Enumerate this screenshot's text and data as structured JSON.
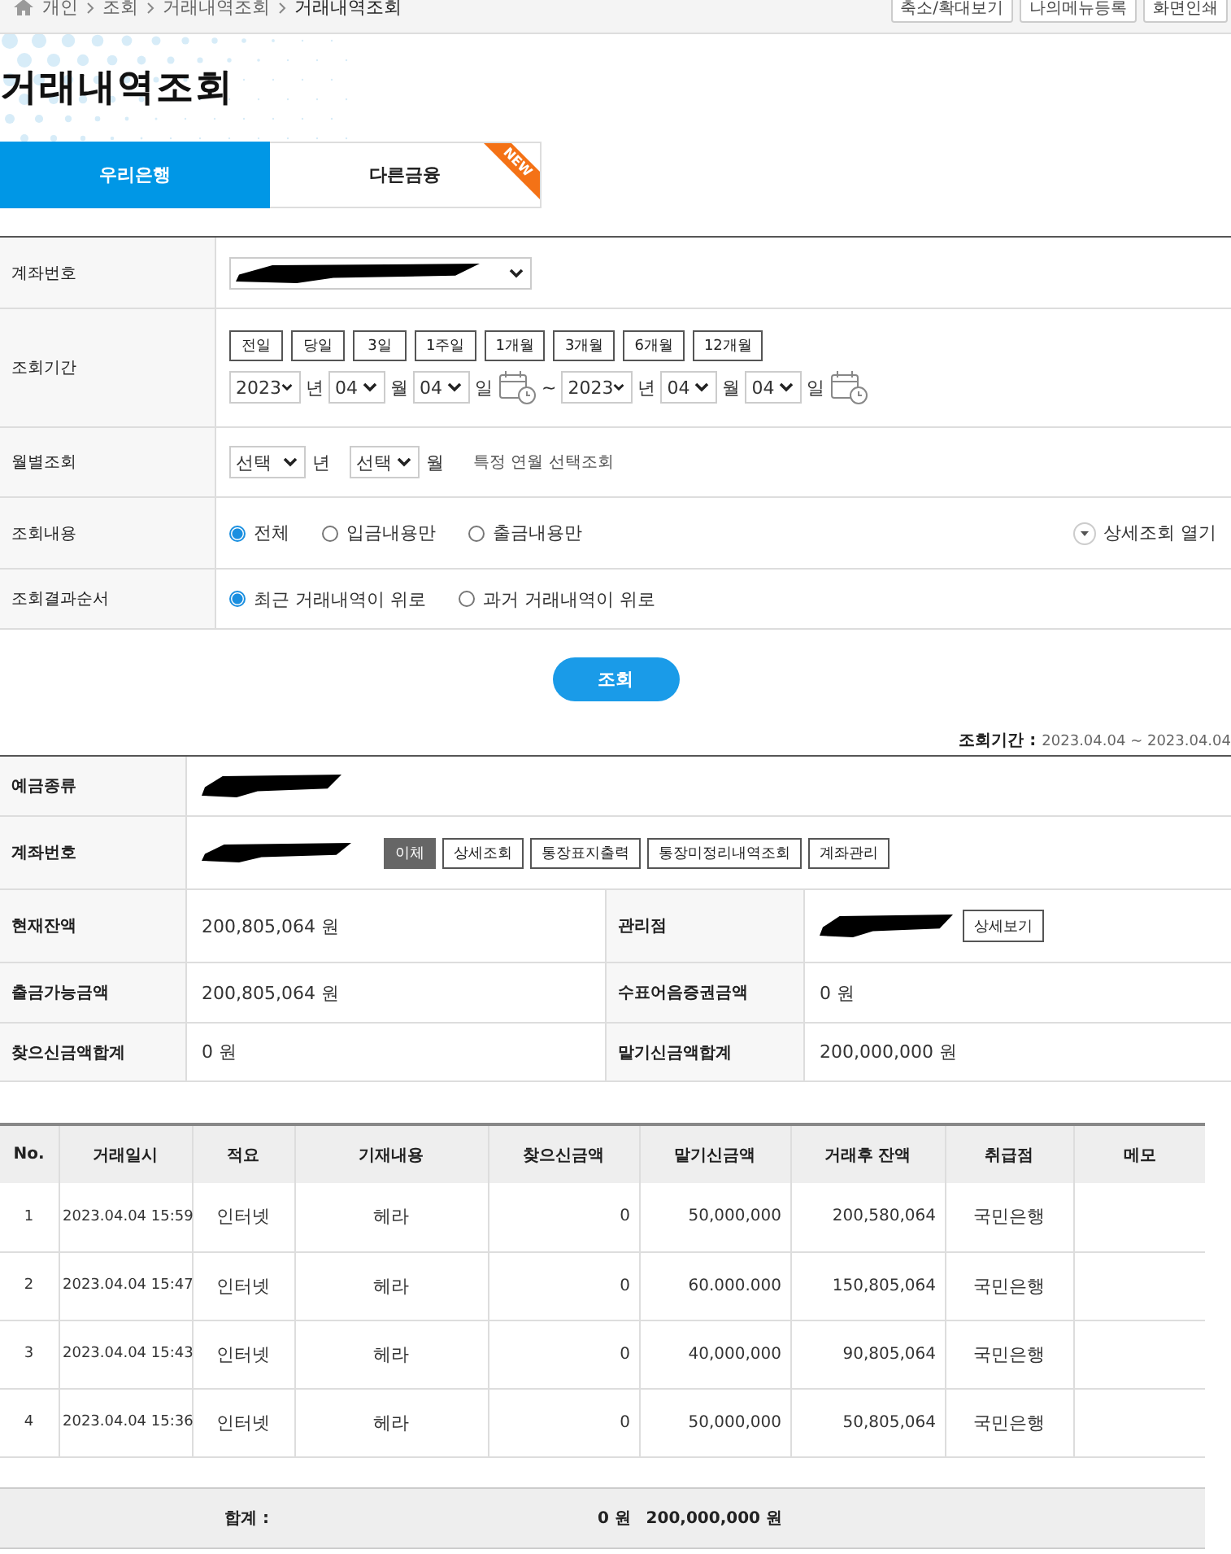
{
  "breadcrumb": {
    "items": [
      "개인",
      "조회",
      "거래내역조회",
      "거래내역조회"
    ]
  },
  "top_buttons": [
    "축소/확대보기",
    "나의메뉴등록",
    "화면인쇄"
  ],
  "page_title": "거래내역조회",
  "tabs": [
    {
      "label": "우리은행",
      "selected": true
    },
    {
      "label": "다른금융",
      "selected": false,
      "badge": "NEW"
    }
  ],
  "search_form": {
    "account": {
      "label": "계좌번호"
    },
    "period": {
      "label": "조회기간",
      "quick_buttons": [
        "전일",
        "당일",
        "3일",
        "1주일",
        "1개월",
        "3개월",
        "6개월",
        "12개월"
      ],
      "from": {
        "year": "2023",
        "year_unit": "년",
        "month": "04",
        "month_unit": "월",
        "day": "04",
        "day_unit": "일"
      },
      "separator": "~",
      "to": {
        "year": "2023",
        "year_unit": "년",
        "month": "04",
        "month_unit": "월",
        "day": "04",
        "day_unit": "일"
      }
    },
    "monthly": {
      "label": "월별조회",
      "year": "선택",
      "year_unit": "년",
      "month": "선택",
      "month_unit": "월",
      "hint": "특정 연월 선택조회"
    },
    "content": {
      "label": "조회내용",
      "options": [
        {
          "label": "전체",
          "selected": true
        },
        {
          "label": "입금내용만",
          "selected": false
        },
        {
          "label": "출금내용만",
          "selected": false
        }
      ],
      "detail_toggle": "상세조회 열기"
    },
    "order": {
      "label": "조회결과순서",
      "options": [
        {
          "label": "최근 거래내역이 위로",
          "selected": true
        },
        {
          "label": "과거 거래내역이 위로",
          "selected": false
        }
      ]
    }
  },
  "search_button": "조회",
  "period_summary": {
    "label": "조회기간 :",
    "value": "2023.04.04 ~ 2023.04.04"
  },
  "account_info": {
    "deposit_type": {
      "label": "예금종류"
    },
    "account_number": {
      "label": "계좌번호",
      "buttons": [
        {
          "label": "이체",
          "kind": "primary"
        },
        {
          "label": "상세조회",
          "kind": "default"
        },
        {
          "label": "통장표지출력",
          "kind": "default"
        },
        {
          "label": "통장미정리내역조회",
          "kind": "default"
        },
        {
          "label": "계좌관리",
          "kind": "default"
        }
      ]
    },
    "pairs": [
      [
        {
          "label": "현재잔액",
          "value": "200,805,064 원"
        },
        {
          "label": "관리점",
          "button": "상세보기"
        }
      ],
      [
        {
          "label": "출금가능금액",
          "value": "200,805,064 원"
        },
        {
          "label": "수표어음증권금액",
          "value": "0 원"
        }
      ],
      [
        {
          "label": "찾으신금액합계",
          "value": "0 원"
        },
        {
          "label": "맡기신금액합계",
          "value": "200,000,000 원"
        }
      ]
    ]
  },
  "transactions": {
    "columns": [
      "No.",
      "거래일시",
      "적요",
      "기재내용",
      "찾으신금액",
      "맡기신금액",
      "거래후 잔액",
      "취급점",
      "메모"
    ],
    "rows": [
      [
        "1",
        "2023.04.04 15:59",
        "인터넷",
        "헤라",
        "0",
        "50,000,000",
        "200,580,064",
        "국민은행"
      ],
      [
        "2",
        "2023.04.04 15:47",
        "인터넷",
        "헤라",
        "0",
        "60.000.000",
        "150,805,064",
        "국민은행"
      ],
      [
        "3",
        "2023.04.04 15:43",
        "인터넷",
        "헤라",
        "0",
        "40,000,000",
        "90,805,064",
        "국민은행"
      ],
      [
        "4",
        "2023.04.04 15:36",
        "인터넷",
        "헤라",
        "0",
        "50,000,000",
        "50,805,064",
        "국민은행"
      ]
    ]
  },
  "totals": {
    "label": "합계 :",
    "withdrawal": "0 원",
    "deposit": "200,000,000 원"
  }
}
